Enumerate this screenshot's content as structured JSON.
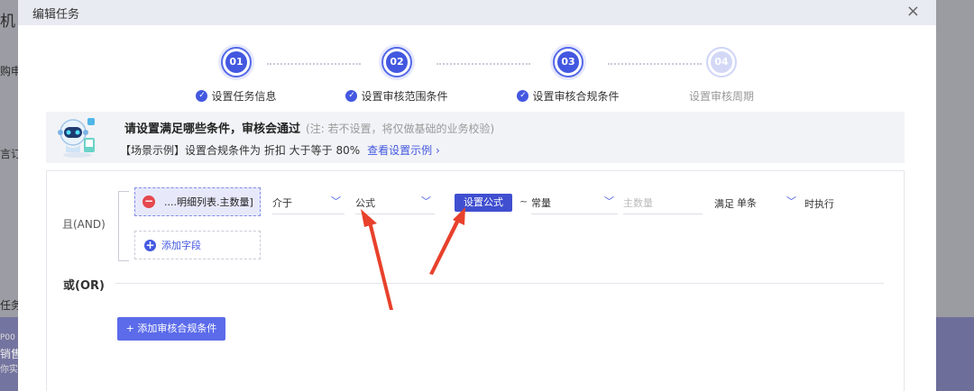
{
  "background": {
    "fragments": [
      "机",
      "购申",
      "言订",
      "任务",
      "P00",
      "销售",
      "你实"
    ]
  },
  "modal": {
    "title": "编辑任务",
    "close_icon": "×"
  },
  "steps": [
    {
      "number": "01",
      "label": "设置任务信息",
      "state": "done"
    },
    {
      "number": "02",
      "label": "设置审核范围条件",
      "state": "done"
    },
    {
      "number": "03",
      "label": "设置审核合规条件",
      "state": "done"
    },
    {
      "number": "04",
      "label": "设置审核周期",
      "state": "pending"
    }
  ],
  "tip": {
    "title": "请设置满足哪些条件，审核会通过",
    "note": "(注: 若不设置，将仅做基础的业务校验)",
    "example_text": "【场景示例】设置合规条件为 折扣 大于等于 80%",
    "example_link": "查看设置示例 ›"
  },
  "conditions": {
    "and_label": "且(AND)",
    "field_chip": "....明细列表.主数量]",
    "add_field": "添加字段",
    "operator": "介于",
    "value_type": "公式",
    "set_formula_button": "设置公式",
    "tilde": "~",
    "second_type": "常量",
    "second_value_placeholder": "主数量",
    "satisfy_label": "满足",
    "satisfy_value": "单条",
    "execute_suffix": "时执行",
    "or_label": "或(OR)",
    "add_condition_button": "+ 添加审核合规条件"
  },
  "colors": {
    "accent": "#4358e0",
    "annotation_arrow": "#e8412c"
  }
}
